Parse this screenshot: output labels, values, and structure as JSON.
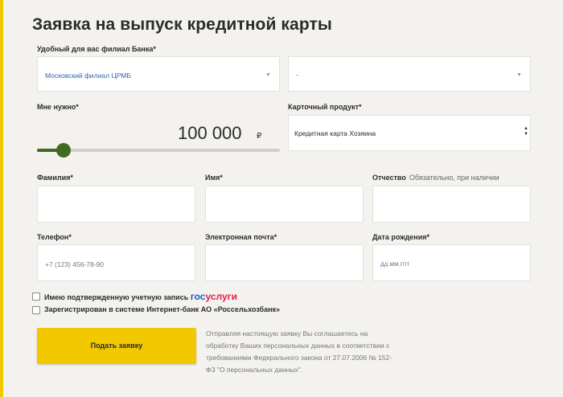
{
  "colors": {
    "accent": "#f2c800",
    "slider": "#3f6b22",
    "link": "#2c66b8"
  },
  "title": "Заявка на выпуск кредитной карты",
  "branch": {
    "label": "Удобный для вас филиал Банка*",
    "value": "Московский филиал ЦРМБ",
    "second_value": "-"
  },
  "amount": {
    "label": "Мне нужно*",
    "value": "100 000",
    "currency": "₽",
    "slider_fraction": 0.11
  },
  "card_product": {
    "label": "Карточный продукт*",
    "value": "Кредитная карта Хозяина"
  },
  "surname": {
    "label": "Фамилия*",
    "value": ""
  },
  "name": {
    "label": "Имя*",
    "value": ""
  },
  "patronymic": {
    "label": "Отчество",
    "hint": "Обязательно, при наличии",
    "value": ""
  },
  "phone": {
    "label": "Телефон*",
    "placeholder": "+7 (123) 456-78-90"
  },
  "email": {
    "label": "Электронная почта*",
    "value": ""
  },
  "birthdate": {
    "label": "Дата рождения*",
    "placeholder": "дд.мм.гггг"
  },
  "gosuslugi": {
    "label": "Имею подтвержденную учетную запись",
    "logo_part1": "гос",
    "logo_part2": "услуги",
    "checked": false
  },
  "internet_bank": {
    "label": "Зарегистрирован в системе Интернет-банк АО «Россельхозбанк»",
    "checked": false
  },
  "submit": {
    "label": "Подать заявку"
  },
  "consent": {
    "line1": "Отправляя настоящую заявку Вы соглашаетесь на",
    "line2": "обработку Ваших персональных данных в соответствии с",
    "line3": "требованиями Федерального закона от 27.07.2006 № 152-",
    "line4": "ФЗ \"О персональных данных\"."
  }
}
